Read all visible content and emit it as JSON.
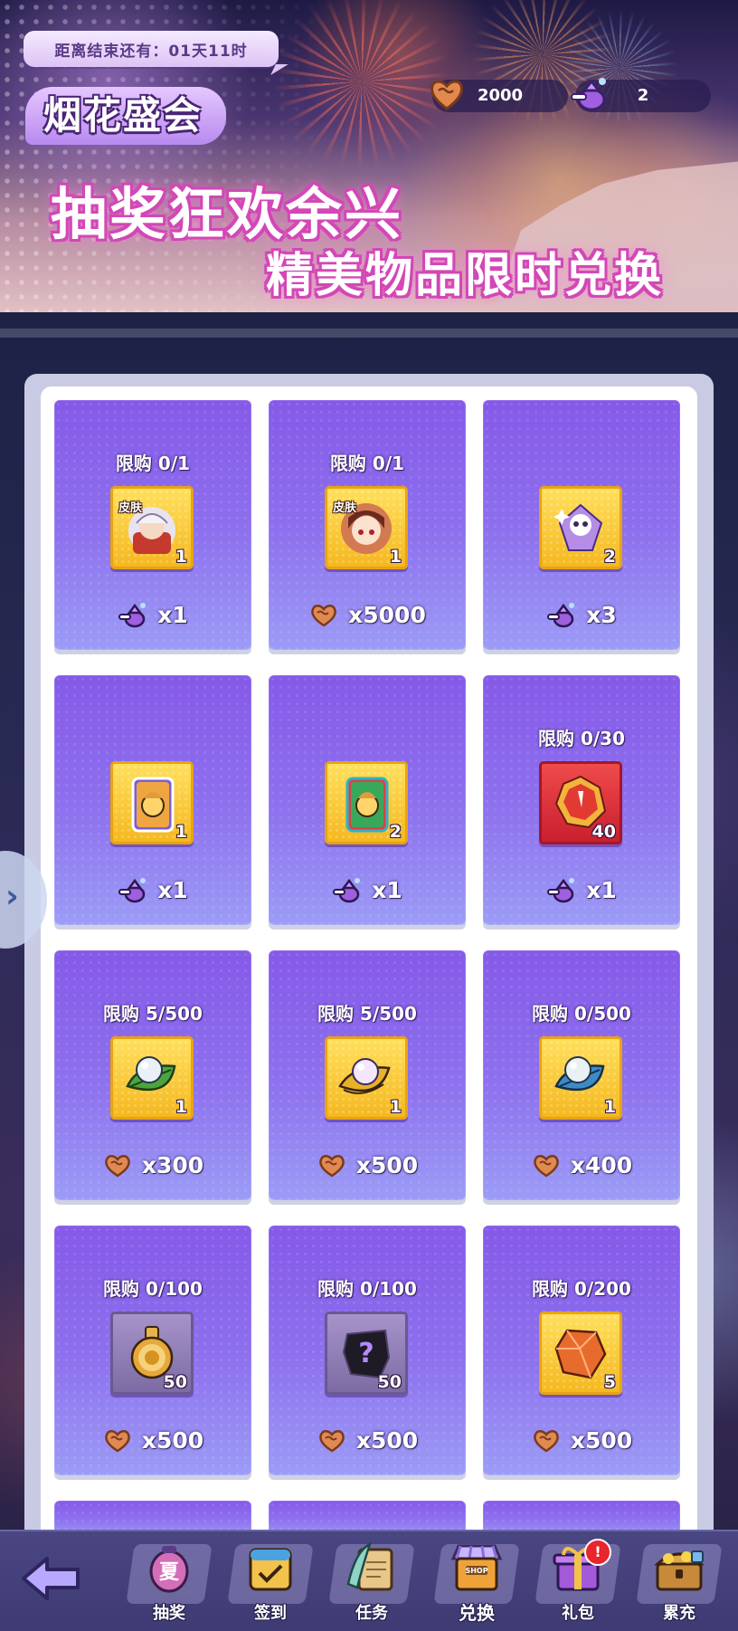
{
  "banner": {
    "countdown": "距离结束还有：01天11时",
    "event_title": "烟花盛会",
    "headline": "抽奖狂欢余兴",
    "subheadline": "精美物品限时兑换",
    "currencies": [
      {
        "icon": "heart-token-icon",
        "value": "2000"
      },
      {
        "icon": "purple-pouch-icon",
        "value": "2"
      }
    ]
  },
  "colors": {
    "card_top": "#8559e8",
    "card_bottom": "#9c9cf6",
    "item_box_gold": "#f5b820",
    "bottom_bar": "#4a4682",
    "headline_glow": "#d347b6"
  },
  "shop": {
    "items": [
      {
        "limit": "限购 0/1",
        "icon": "skin-avatar-white-hair-icon",
        "tag": "皮肤",
        "qty": "1",
        "price_icon": "purple-pouch-icon",
        "price": "x1"
      },
      {
        "limit": "限购 0/1",
        "icon": "skin-avatar-red-hair-icon",
        "tag": "皮肤",
        "qty": "1",
        "price_icon": "heart-token-icon",
        "price": "x5000"
      },
      {
        "limit": "",
        "icon": "ghost-gem-icon",
        "tag": "",
        "qty": "2",
        "price_icon": "purple-pouch-icon",
        "price": "x3"
      },
      {
        "limit": "",
        "icon": "rainbow-card-icon",
        "tag": "",
        "qty": "1",
        "price_icon": "purple-pouch-icon",
        "price": "x1"
      },
      {
        "limit": "",
        "icon": "green-card-icon",
        "tag": "",
        "qty": "2",
        "price_icon": "purple-pouch-icon",
        "price": "x1"
      },
      {
        "limit": "限购 0/30",
        "icon": "red-shard-icon",
        "tag": "",
        "qty": "40",
        "price_icon": "purple-pouch-icon",
        "price": "x1"
      },
      {
        "limit": "限购 5/500",
        "icon": "green-leaf-pearl-icon",
        "tag": "",
        "qty": "1",
        "price_icon": "heart-token-icon",
        "price": "x300"
      },
      {
        "limit": "限购 5/500",
        "icon": "golden-pearl-icon",
        "tag": "",
        "qty": "1",
        "price_icon": "heart-token-icon",
        "price": "x500"
      },
      {
        "limit": "限购 0/500",
        "icon": "blue-leaf-pearl-icon",
        "tag": "",
        "qty": "1",
        "price_icon": "heart-token-icon",
        "price": "x400"
      },
      {
        "limit": "限购 0/100",
        "icon": "gold-medal-icon",
        "tag": "",
        "qty": "50",
        "price_icon": "heart-token-icon",
        "price": "x500"
      },
      {
        "limit": "限购 0/100",
        "icon": "mystery-shard-icon",
        "tag": "",
        "qty": "50",
        "price_icon": "heart-token-icon",
        "price": "x500"
      },
      {
        "limit": "限购 0/200",
        "icon": "orange-crystal-icon",
        "tag": "",
        "qty": "5",
        "price_icon": "heart-token-icon",
        "price": "x500"
      }
    ]
  },
  "nav": {
    "back_icon": "back-arrow-icon",
    "items": [
      {
        "label": "抽奖",
        "icon": "summer-lantern-icon"
      },
      {
        "label": "签到",
        "icon": "calendar-check-icon"
      },
      {
        "label": "任务",
        "icon": "quest-scroll-icon"
      },
      {
        "label": "兑换",
        "icon": "shop-stall-icon",
        "active": true
      },
      {
        "label": "礼包",
        "icon": "gift-box-icon",
        "badge": "!"
      },
      {
        "label": "累充",
        "icon": "treasure-chest-icon"
      }
    ]
  }
}
